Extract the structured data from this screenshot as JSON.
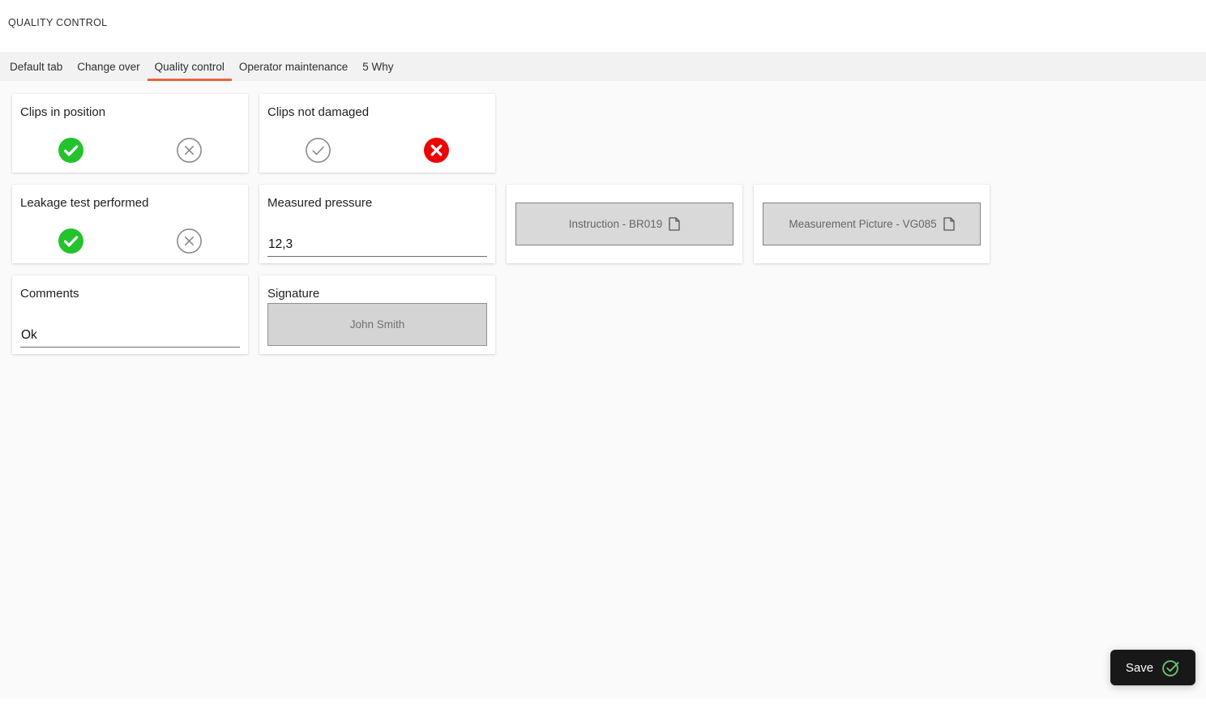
{
  "header": {
    "title": "QUALITY CONTROL"
  },
  "tab_bar": {
    "active_tab": "Quality control",
    "items": [
      {
        "label": "Default tab"
      },
      {
        "label": "Change over"
      },
      {
        "label": "Quality control"
      },
      {
        "label": "Operator maintenance"
      },
      {
        "label": "5 Why"
      }
    ]
  },
  "form": {
    "clips_in_position": {
      "label": "Clips in position",
      "value": "pass",
      "pass_icon": "check-circle-filled-green-icon",
      "fail_icon": "x-circle-outline-gray-icon"
    },
    "clips_not_damaged": {
      "label": "Clips not damaged",
      "value": "fail",
      "pass_icon": "check-circle-outline-gray-icon",
      "fail_icon": "x-circle-filled-red-icon"
    },
    "leakage_test_performed": {
      "label": "Leakage test performed",
      "value": "pass",
      "pass_icon": "check-circle-filled-green-icon",
      "fail_icon": "x-circle-outline-gray-icon"
    },
    "measured_pressure": {
      "label": "Measured pressure",
      "value": "12,3"
    },
    "instruction_document": {
      "label": "Instruction - BR019",
      "icon": "document-icon"
    },
    "measurement_picture_document": {
      "label": "Measurement Picture - VG085",
      "icon": "document-icon"
    },
    "comments": {
      "label": "Comments",
      "value": "Ok"
    },
    "signature": {
      "label": "Signature",
      "value": "John Smith"
    }
  },
  "actions": {
    "save_label": "Save",
    "save_icon": "check-circle-outline-green-icon"
  },
  "colors": {
    "tab_accent_orange": "#eb643c",
    "pass_green": "#23c32d",
    "fail_red": "#ee0202",
    "neutral_icon_gray": "#8a8a8a",
    "save_button_bg": "#181818",
    "save_icon_green": "#6cc06c",
    "tabbar_bg": "#f2f2f2",
    "content_bg": "#fafafa"
  }
}
